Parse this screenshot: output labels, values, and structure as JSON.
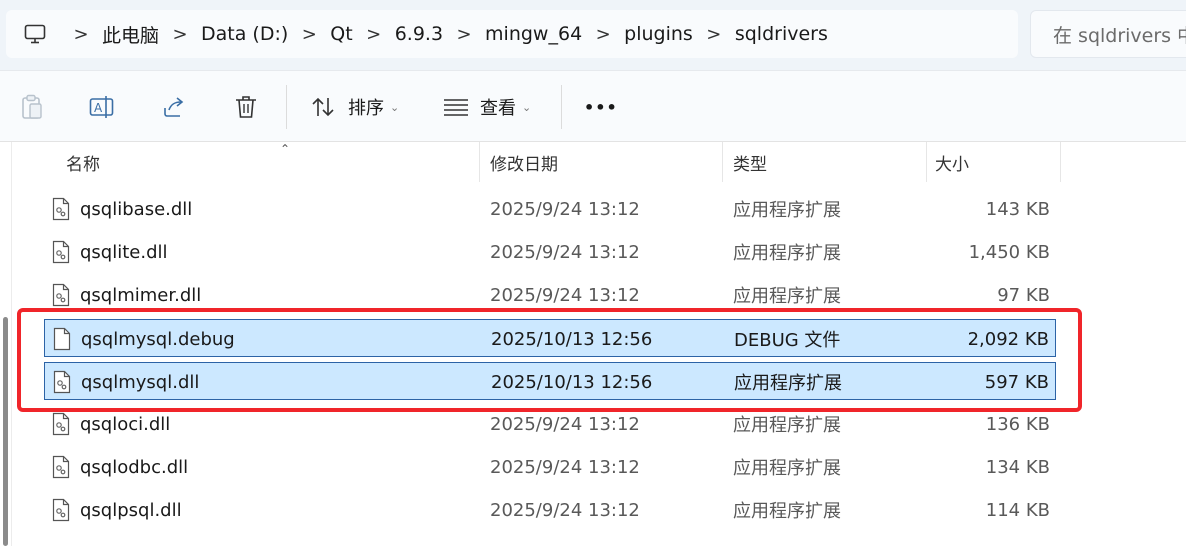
{
  "address_bar": {
    "crumbs": [
      "此电脑",
      "Data (D:)",
      "Qt",
      "6.9.3",
      "mingw_64",
      "plugins",
      "sqldrivers"
    ],
    "separator": ">",
    "pc_icon": "computer-icon"
  },
  "search": {
    "placeholder": "在 sqldrivers 中"
  },
  "toolbar": {
    "paste_icon": "paste-icon",
    "rename_icon": "rename-icon",
    "share_icon": "share-icon",
    "delete_icon": "delete-icon",
    "sort_label": "排序",
    "view_label": "查看",
    "more_label": "•••"
  },
  "columns": {
    "name": "名称",
    "date": "修改日期",
    "type": "类型",
    "size": "大小"
  },
  "files": [
    {
      "name": "qsqlibase.dll",
      "date": "2025/9/24 13:12",
      "type": "应用程序扩展",
      "size": "143 KB",
      "icon": "dll-file-icon",
      "selected": false
    },
    {
      "name": "qsqlite.dll",
      "date": "2025/9/24 13:12",
      "type": "应用程序扩展",
      "size": "1,450 KB",
      "icon": "dll-file-icon",
      "selected": false
    },
    {
      "name": "qsqlmimer.dll",
      "date": "2025/9/24 13:12",
      "type": "应用程序扩展",
      "size": "97 KB",
      "icon": "dll-file-icon",
      "selected": false
    },
    {
      "name": "qsqlmysql.debug",
      "date": "2025/10/13 12:56",
      "type": "DEBUG 文件",
      "size": "2,092 KB",
      "icon": "blank-file-icon",
      "selected": true
    },
    {
      "name": "qsqlmysql.dll",
      "date": "2025/10/13 12:56",
      "type": "应用程序扩展",
      "size": "597 KB",
      "icon": "dll-file-icon",
      "selected": true
    },
    {
      "name": "qsqloci.dll",
      "date": "2025/9/24 13:12",
      "type": "应用程序扩展",
      "size": "136 KB",
      "icon": "dll-file-icon",
      "selected": false
    },
    {
      "name": "qsqlodbc.dll",
      "date": "2025/9/24 13:12",
      "type": "应用程序扩展",
      "size": "134 KB",
      "icon": "dll-file-icon",
      "selected": false
    },
    {
      "name": "qsqlpsql.dll",
      "date": "2025/9/24 13:12",
      "type": "应用程序扩展",
      "size": "114 KB",
      "icon": "dll-file-icon",
      "selected": false
    }
  ],
  "colors": {
    "selection": "#cce8ff",
    "selection_border": "#2c63a6",
    "annotation": "#f0252a"
  }
}
